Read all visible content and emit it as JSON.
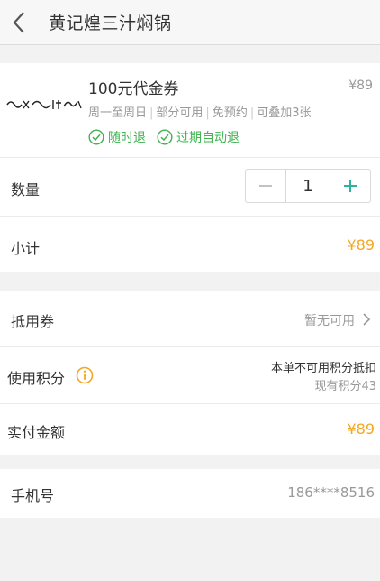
{
  "header": {
    "title": "黄记煌三汁焖锅"
  },
  "deal": {
    "title": "100元代金券",
    "price": "¥89",
    "meta": [
      "周一至周日",
      "部分可用",
      "免预约",
      "可叠加3张"
    ],
    "tags": [
      "随时退",
      "过期自动退"
    ]
  },
  "quantity": {
    "label": "数量",
    "value": "1"
  },
  "subtotal": {
    "label": "小计",
    "value": "¥89"
  },
  "voucher": {
    "label": "抵用券",
    "value": "暂无可用"
  },
  "points": {
    "label": "使用积分",
    "status": "本单不可用积分抵扣",
    "balance": "现有积分43"
  },
  "pay": {
    "label": "实付金额",
    "value": "¥89"
  },
  "phone": {
    "label": "手机号",
    "value": "186****8516"
  },
  "colors": {
    "accent_green": "#3fb34f",
    "price_orange": "#f5a623"
  }
}
